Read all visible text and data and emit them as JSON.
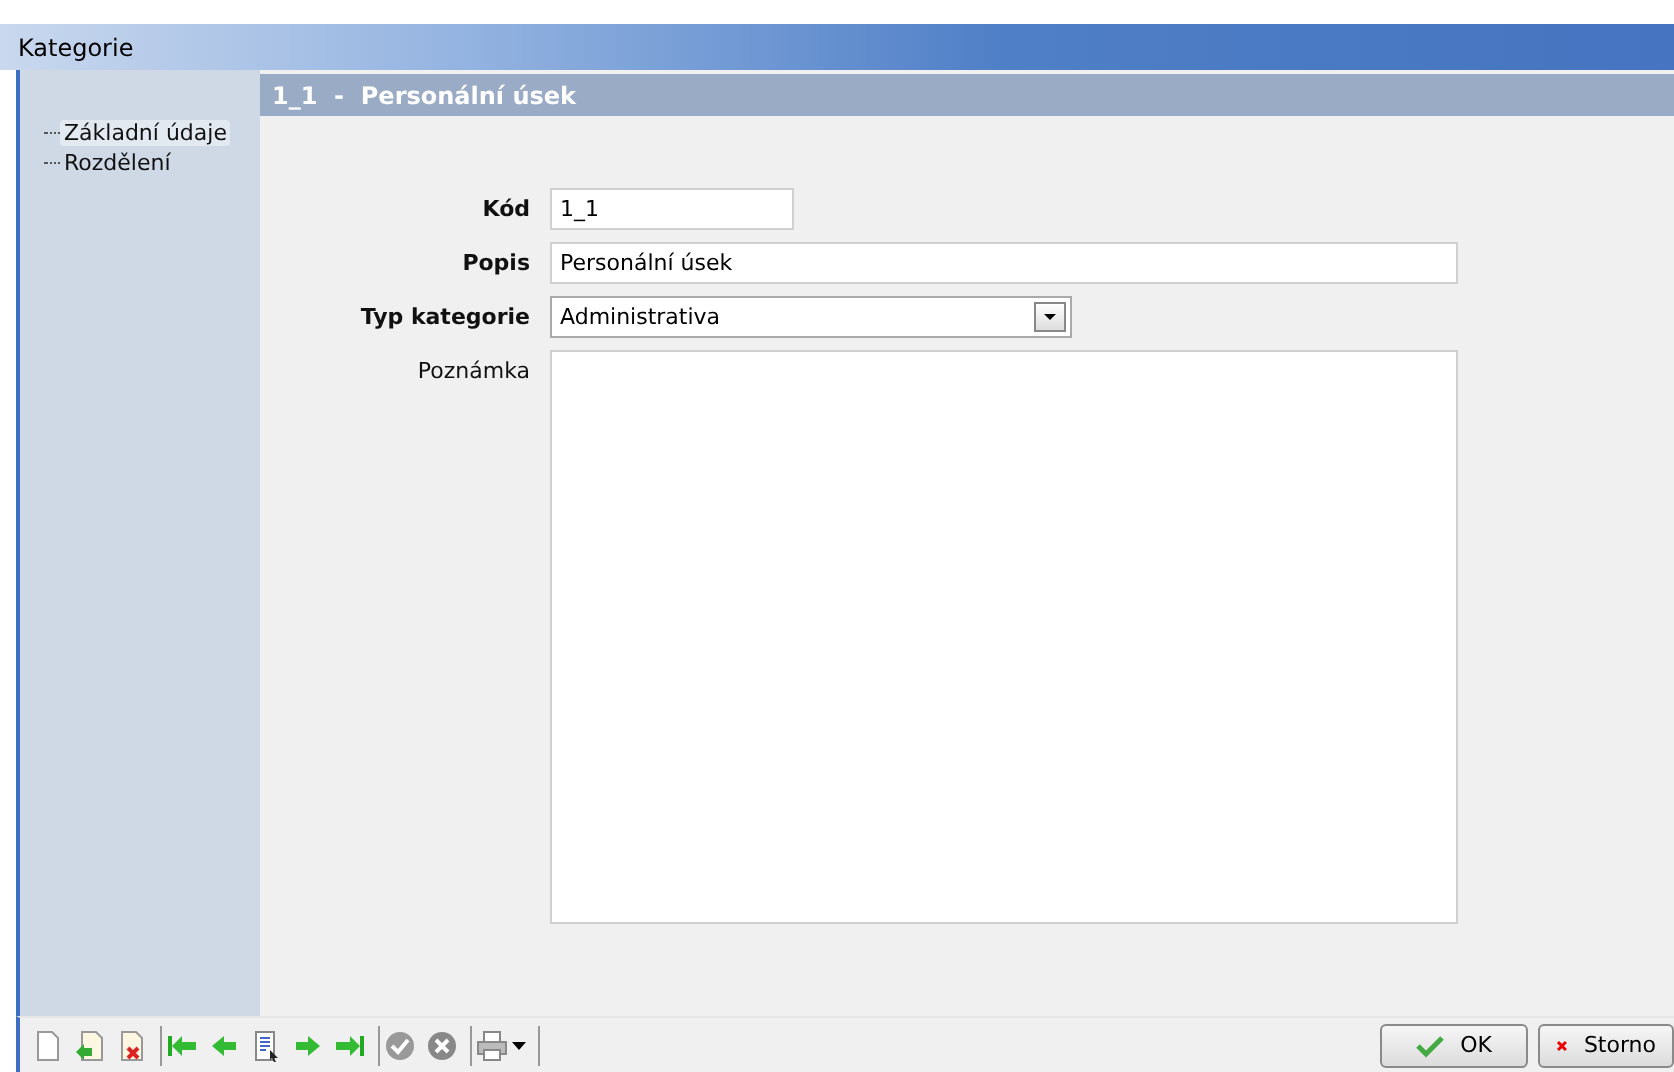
{
  "window": {
    "title": "Kategorie"
  },
  "sidebar": {
    "items": [
      {
        "label": "Základní údaje",
        "selected": true
      },
      {
        "label": "Rozdělení",
        "selected": false
      }
    ]
  },
  "header": {
    "title": "1_1  -  Personální úsek"
  },
  "fields": [
    {
      "kind": "short_text",
      "label": "Kód",
      "required": true,
      "value": "1_1"
    },
    {
      "kind": "text",
      "label": "Popis",
      "required": true,
      "value": "Personální úsek"
    },
    {
      "kind": "select",
      "label": "Typ kategorie",
      "required": true,
      "value": "Administrativa"
    },
    {
      "kind": "textarea",
      "label": "Poznámka",
      "required": false
    }
  ],
  "buttons": [
    {
      "kind": "ok",
      "label": "OK"
    },
    {
      "kind": "cancel",
      "label": "Storno"
    }
  ]
}
